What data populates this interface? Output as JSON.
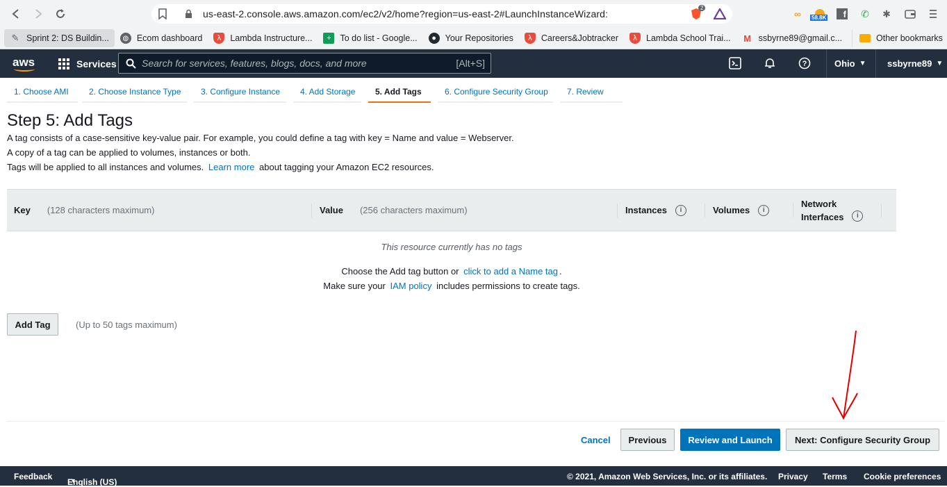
{
  "browser": {
    "url": "us-east-2.console.aws.amazon.com/ec2/v2/home?region=us-east-2#LaunchInstanceWizard:",
    "brave_badge": "2",
    "ext_badge": "58.8K",
    "bookmarks": [
      "Sprint 2: DS Buildin...",
      "Ecom dashboard",
      "Lambda Instructure...",
      "To do list - Google...",
      "Your Repositories",
      "Careers&Jobtracker",
      "Lambda School Trai...",
      "ssbyrne89@gmail.c..."
    ],
    "bookmarks_more": "»",
    "other_bookmarks": "Other bookmarks"
  },
  "aws": {
    "logo": "aws",
    "services_label": "Services",
    "search_placeholder": "Search for services, features, blogs, docs, and more",
    "search_shortcut": "[Alt+S]",
    "region": "Ohio",
    "user": "ssbyrne89"
  },
  "steps": [
    "1. Choose AMI",
    "2. Choose Instance Type",
    "3. Configure Instance",
    "4. Add Storage",
    "5. Add Tags",
    "6. Configure Security Group",
    "7. Review"
  ],
  "page": {
    "title": "Step 5: Add Tags",
    "desc1": "A tag consists of a case-sensitive key-value pair. For example, you could define a tag with key = Name and value = Webserver.",
    "desc2": "A copy of a tag can be applied to volumes, instances or both.",
    "desc3_pre": "Tags will be applied to all instances and volumes.",
    "desc3_link": "Learn more",
    "desc3_post": "about tagging your Amazon EC2 resources."
  },
  "table": {
    "key_label": "Key",
    "key_hint": "(128 characters maximum)",
    "value_label": "Value",
    "value_hint": "(256 characters maximum)",
    "instances_label": "Instances",
    "volumes_label": "Volumes",
    "network_label_1": "Network",
    "network_label_2": "Interfaces",
    "info_glyph": "i",
    "empty_msg": "This resource currently has no tags",
    "choose_pre": "Choose the Add tag button or",
    "choose_link": "click to add a Name tag",
    "choose_post": ".",
    "iam_pre": "Make sure your",
    "iam_link": "IAM policy",
    "iam_post": "includes permissions to create tags."
  },
  "add_tag": {
    "label": "Add Tag",
    "hint": "(Up to 50 tags maximum)"
  },
  "actions": {
    "cancel": "Cancel",
    "previous": "Previous",
    "review_launch": "Review and Launch",
    "next": "Next: Configure Security Group"
  },
  "footer": {
    "feedback": "Feedback",
    "language": "English (US)",
    "copyright": "© 2021, Amazon Web Services, Inc. or its affiliates.",
    "privacy": "Privacy",
    "terms": "Terms",
    "cookies": "Cookie preferences"
  },
  "colors": {
    "aws_nav": "#232f3e",
    "link": "#0073bb",
    "active_step": "#ec7211",
    "annotation_arrow": "#e00000"
  }
}
